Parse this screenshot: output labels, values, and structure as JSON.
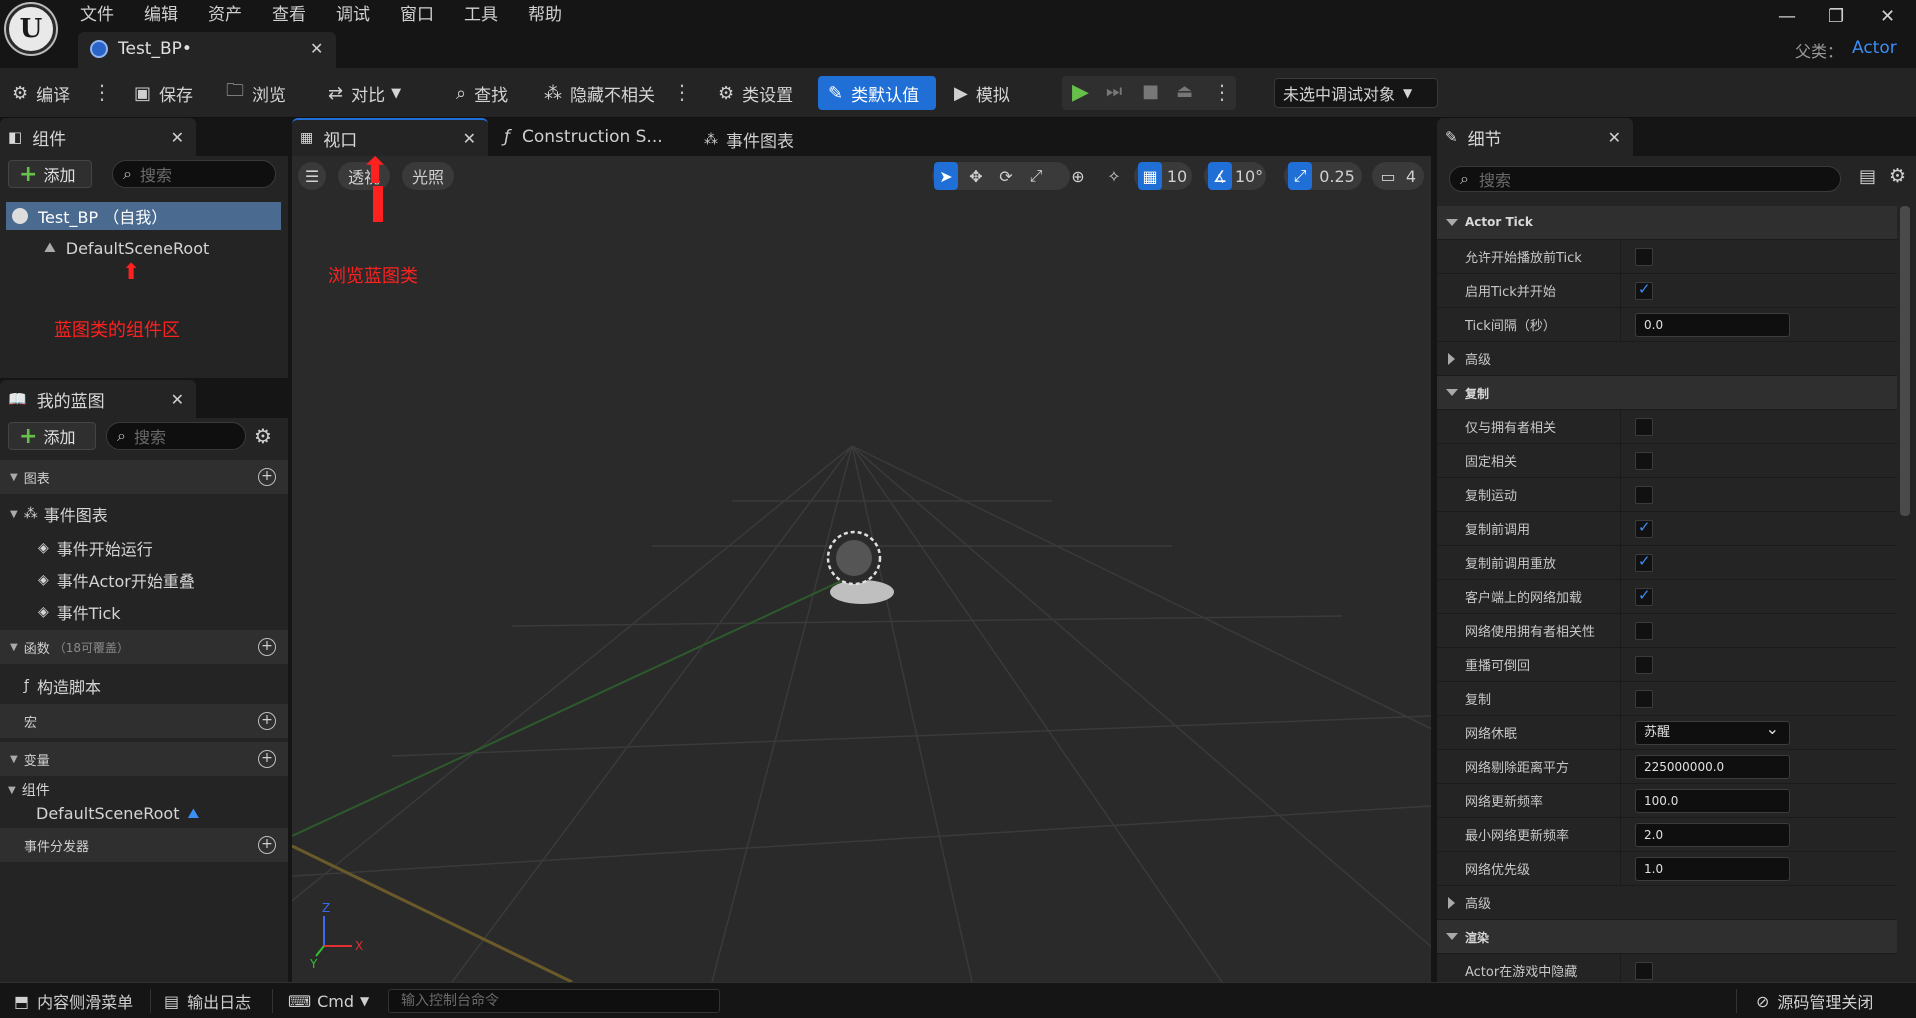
{
  "menu": [
    "文件",
    "编辑",
    "资产",
    "查看",
    "调试",
    "窗口",
    "工具",
    "帮助"
  ],
  "doc_tab": {
    "label": "Test_BP•"
  },
  "parent_class": {
    "label": "父类：",
    "value": "Actor"
  },
  "toolbar": {
    "compile": "编译",
    "save": "保存",
    "browse": "浏览",
    "diff": "对比",
    "find": "查找",
    "hide_unrelated": "隐藏不相关",
    "class_settings": "类设置",
    "class_defaults": "类默认值",
    "simulate": "模拟",
    "debug_target": "未选中调试对象"
  },
  "components_panel": {
    "title": "组件",
    "add": "添加",
    "search_placeholder": "搜索",
    "root_item": "Test_BP （自我）",
    "child_item": "DefaultSceneRoot",
    "annotation": "蓝图类的组件区"
  },
  "my_blueprint": {
    "title": "我的蓝图",
    "add": "添加",
    "search_placeholder": "搜索",
    "graphs_header": "图表",
    "event_graph": "事件图表",
    "events": [
      "事件开始运行",
      "事件Actor开始重叠",
      "事件Tick"
    ],
    "functions_header": "函数",
    "functions_note": "（18可覆盖）",
    "construction_script": "构造脚本",
    "macros_header": "宏",
    "variables_header": "变量",
    "components_group": "组件",
    "var_item": "DefaultSceneRoot",
    "dispatchers_header": "事件分发器"
  },
  "center_tabs": {
    "viewport": "视口",
    "construction": "Construction S...",
    "event_graph": "事件图表"
  },
  "viewport": {
    "perspective": "透视",
    "lighting": "光照",
    "grid_snap": "10",
    "rot_snap": "10°",
    "scale_snap": "0.25",
    "camera_speed": "4",
    "annotation": "浏览蓝图类"
  },
  "details": {
    "title": "细节",
    "search_placeholder": "搜索",
    "rows": [
      {
        "type": "section",
        "label": "Actor Tick",
        "open": true
      },
      {
        "type": "check",
        "label": "允许开始播放前Tick",
        "checked": false
      },
      {
        "type": "check",
        "label": "启用Tick并开始",
        "checked": true
      },
      {
        "type": "num",
        "label": "Tick间隔（秒）",
        "value": "0.0"
      },
      {
        "type": "sub",
        "label": "高级"
      },
      {
        "type": "section",
        "label": "复制",
        "open": true
      },
      {
        "type": "check",
        "label": "仅与拥有者相关",
        "checked": false
      },
      {
        "type": "check",
        "label": "固定相关",
        "checked": false
      },
      {
        "type": "check",
        "label": "复制运动",
        "checked": false
      },
      {
        "type": "check",
        "label": "复制前调用",
        "checked": true
      },
      {
        "type": "check",
        "label": "复制前调用重放",
        "checked": true
      },
      {
        "type": "check",
        "label": "客户端上的网络加载",
        "checked": true
      },
      {
        "type": "check",
        "label": "网络使用拥有者相关性",
        "checked": false
      },
      {
        "type": "check",
        "label": "重播可倒回",
        "checked": false
      },
      {
        "type": "check",
        "label": "复制",
        "checked": false
      },
      {
        "type": "select",
        "label": "网络休眠",
        "value": "苏醒"
      },
      {
        "type": "num",
        "label": "网络剔除距离平方",
        "value": "225000000.0"
      },
      {
        "type": "num",
        "label": "网络更新频率",
        "value": "100.0"
      },
      {
        "type": "num",
        "label": "最小网络更新频率",
        "value": "2.0"
      },
      {
        "type": "num",
        "label": "网络优先级",
        "value": "1.0"
      },
      {
        "type": "sub",
        "label": "高级"
      },
      {
        "type": "section",
        "label": "渲染",
        "open": true
      },
      {
        "type": "check",
        "label": "Actor在游戏中隐藏",
        "checked": false
      }
    ]
  },
  "bottom": {
    "content_drawer": "内容侧滑菜单",
    "output_log": "输出日志",
    "cmd": "Cmd",
    "console_placeholder": "输入控制台命令",
    "source_control": "源码管理关闭"
  },
  "colors": {
    "accent": "#1f6fd6",
    "parent_class": "#3a8ef6",
    "annotation": "#ff2020",
    "play": "#66c04a"
  }
}
